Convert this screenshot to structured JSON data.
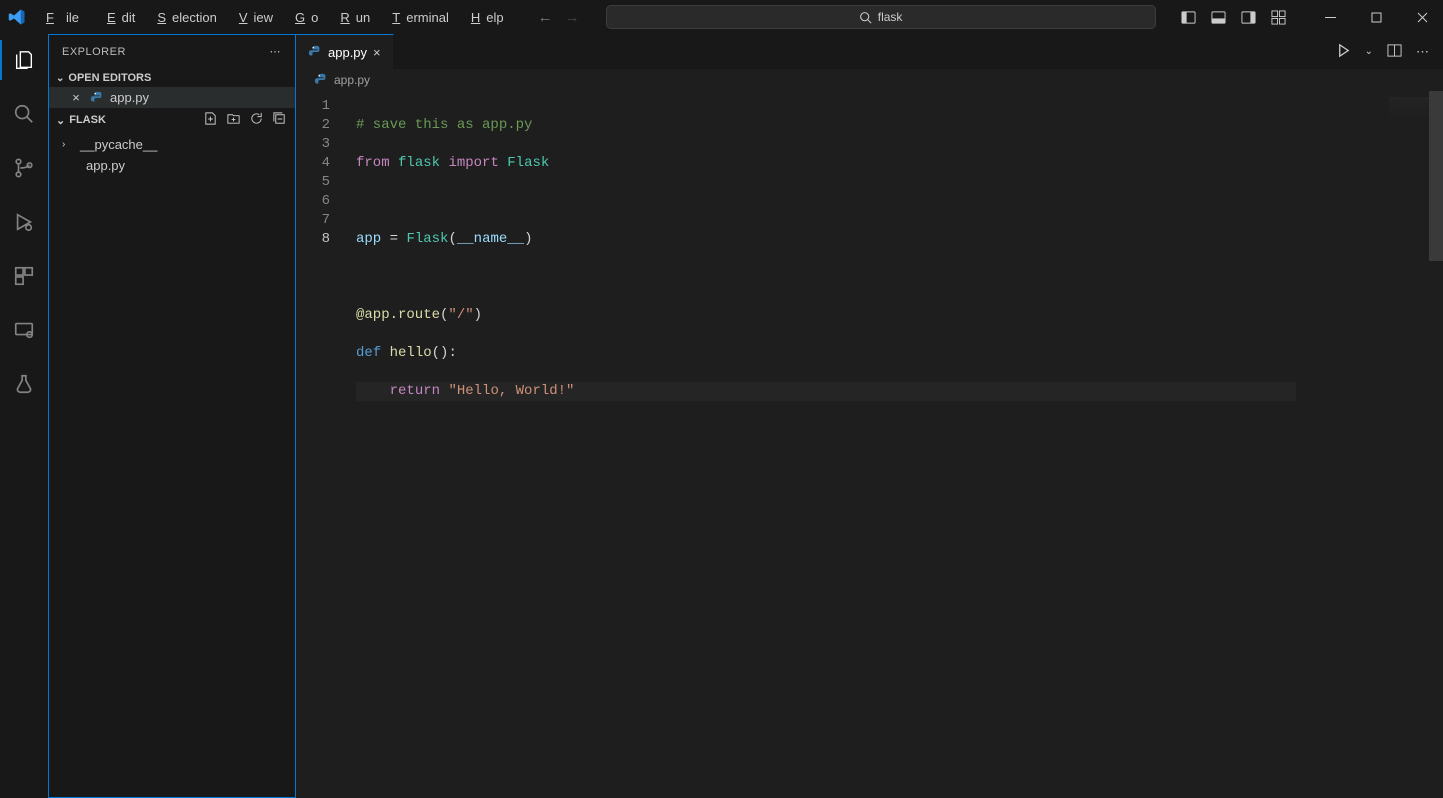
{
  "menu": {
    "file": "File",
    "edit": "Edit",
    "selection": "Selection",
    "view": "View",
    "go": "Go",
    "run": "Run",
    "terminal": "Terminal",
    "help": "Help"
  },
  "search": {
    "value": "flask"
  },
  "explorer": {
    "title": "EXPLORER",
    "open_editors_label": "OPEN EDITORS",
    "open_editor_file": "app.py",
    "folder_name": "FLASK",
    "tree": {
      "pycache": "__pycache__",
      "apppy": "app.py"
    }
  },
  "tabs": {
    "active": "app.py"
  },
  "breadcrumb": {
    "file": "app.py"
  },
  "code": {
    "lines": [
      "1",
      "2",
      "3",
      "4",
      "5",
      "6",
      "7",
      "8"
    ],
    "l1": "# save this as app.py",
    "l2_from": "from",
    "l2_mod": "flask",
    "l2_import": "import",
    "l2_cls": "Flask",
    "l4_app": "app",
    "l4_eq": " = ",
    "l4_cls": "Flask",
    "l4_open": "(",
    "l4_name": "__name__",
    "l4_close": ")",
    "l6_deco": "@app.route",
    "l6_open": "(",
    "l6_str": "\"/\"",
    "l6_close": ")",
    "l7_def": "def",
    "l7_fn": "hello",
    "l7_rest": "():",
    "l8_ret": "return",
    "l8_str": "\"Hello, World!\""
  }
}
